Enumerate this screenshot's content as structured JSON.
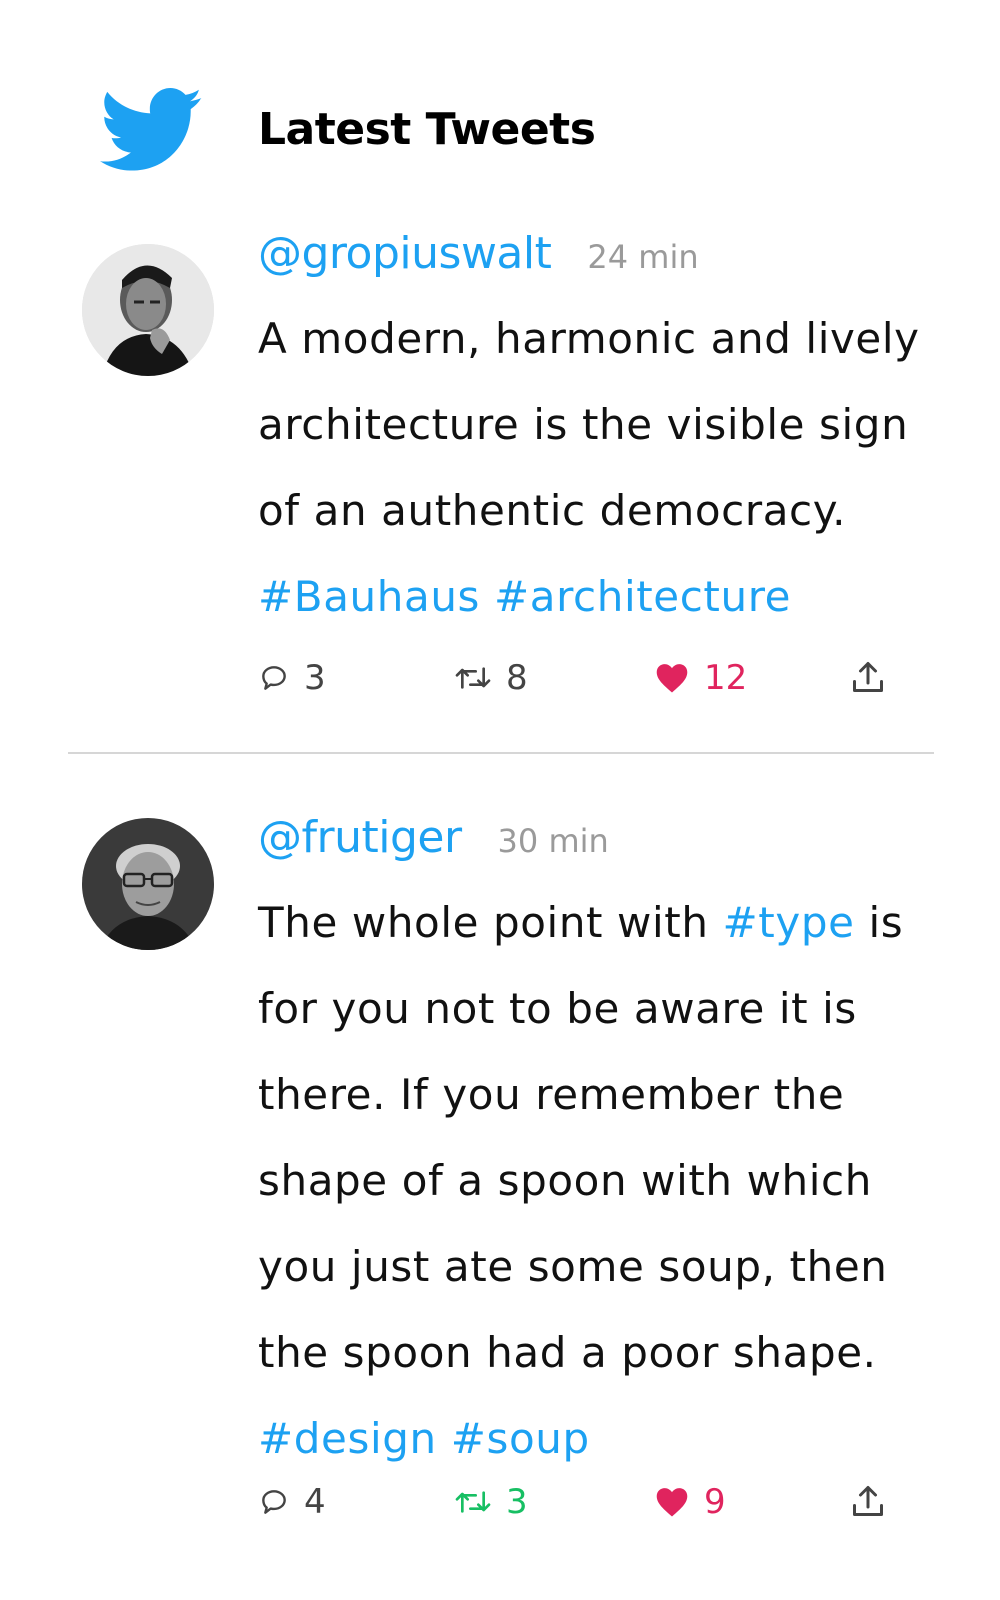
{
  "header": {
    "title": "Latest Tweets",
    "icon": "twitter-bird-icon",
    "brand_color": "#1da1f2"
  },
  "tweets": [
    {
      "handle": "@gropiuswalt",
      "time": "24 min",
      "avatar": "avatar-photo",
      "lines": [
        "A modern, harmonic and lively",
        "architecture is the visible sign",
        "of an authentic democracy."
      ],
      "hashtags": [
        "#Bauhaus",
        "#architecture"
      ],
      "replies": "3",
      "retweets": "8",
      "likes": "12",
      "retweet_active": false,
      "like_active": true
    },
    {
      "handle": "@frutiger",
      "time": "30 min",
      "avatar": "avatar-photo",
      "line1_before": "The whole point with",
      "line1_tag": "#type",
      "line1_after": "is",
      "lines": [
        "for you not to be aware it is",
        "there. If you remember the",
        "shape of a spoon with which",
        "you just ate some soup, then",
        "the spoon had a poor shape."
      ],
      "hashtags": [
        "#design",
        "#soup"
      ],
      "replies": "4",
      "retweets": "3",
      "likes": "9",
      "retweet_active": true,
      "like_active": true
    }
  ],
  "colors": {
    "link": "#1da1f2",
    "like": "#e0245e",
    "retweet_active": "#17bf63",
    "muted": "#9a9a9a",
    "text": "#111111"
  }
}
